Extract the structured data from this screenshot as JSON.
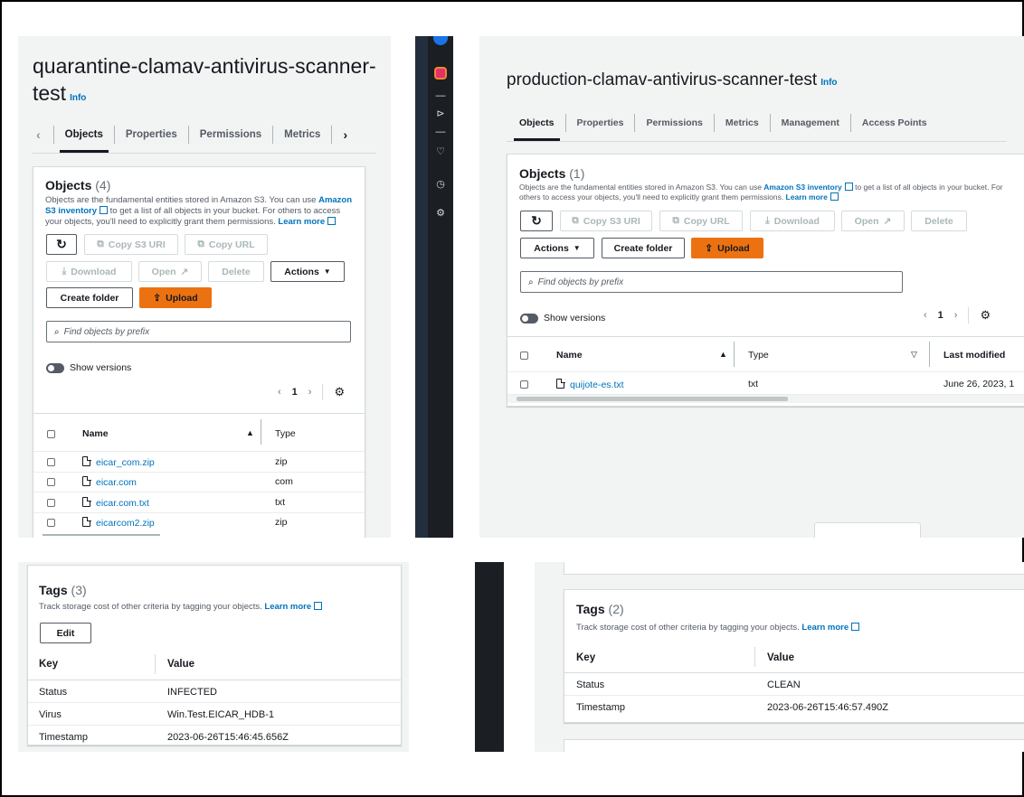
{
  "left_panel": {
    "title_line1": "quarantine-clamav-antivirus-scanner-",
    "title_line2": "test",
    "info": "Info",
    "tabs": [
      "Objects",
      "Properties",
      "Permissions",
      "Metrics"
    ],
    "objects": {
      "title": "Objects",
      "count": "(4)",
      "description_pre": "Objects are the fundamental entities stored in Amazon S3. You can use ",
      "description_link": "Amazon S3 inventory",
      "description_mid": " to get a list of all objects in your bucket. For others to access your objects, you'll need to explicitly grant them permissions. ",
      "description_learn": "Learn more",
      "copy_s3_uri": "Copy S3 URI",
      "copy_url": "Copy URL",
      "download": "Download",
      "open": "Open",
      "delete": "Delete",
      "actions": "Actions",
      "create_folder": "Create folder",
      "upload": "Upload",
      "search_placeholder": "Find objects by prefix",
      "show_versions": "Show versions",
      "page": "1",
      "col_name": "Name",
      "col_type": "Type",
      "rows": [
        {
          "name": "eicar_com.zip",
          "type": "zip"
        },
        {
          "name": "eicar.com",
          "type": "com"
        },
        {
          "name": "eicar.com.txt",
          "type": "txt"
        },
        {
          "name": "eicarcom2.zip",
          "type": "zip"
        }
      ]
    }
  },
  "right_panel": {
    "title": "production-clamav-antivirus-scanner-test",
    "info": "Info",
    "tabs": [
      "Objects",
      "Properties",
      "Permissions",
      "Metrics",
      "Management",
      "Access Points"
    ],
    "objects": {
      "title": "Objects",
      "count": "(1)",
      "description_pre": "Objects are the fundamental entities stored in Amazon S3. You can use ",
      "description_link": "Amazon S3 inventory",
      "description_mid": " to get a list of all objects in your bucket. For others to access your objects, you'll need to explicitly grant them permissions. ",
      "description_learn": "Learn more",
      "copy_s3_uri": "Copy S3 URI",
      "copy_url": "Copy URL",
      "download": "Download",
      "open": "Open",
      "delete": "Delete",
      "actions": "Actions",
      "create_folder": "Create folder",
      "upload": "Upload",
      "search_placeholder": "Find objects by prefix",
      "show_versions": "Show versions",
      "page": "1",
      "col_name": "Name",
      "col_type": "Type",
      "col_last_modified": "Last modified",
      "rows": [
        {
          "name": "quijote-es.txt",
          "type": "txt",
          "last_modified": "June 26, 2023, 1"
        }
      ]
    }
  },
  "left_tags": {
    "title": "Tags",
    "count": "(3)",
    "description": "Track storage cost of other criteria by tagging your objects.",
    "learn_more": "Learn more",
    "edit": "Edit",
    "col_key": "Key",
    "col_value": "Value",
    "rows": [
      {
        "key": "Status",
        "value": "INFECTED"
      },
      {
        "key": "Virus",
        "value": "Win.Test.EICAR_HDB-1"
      },
      {
        "key": "Timestamp",
        "value": "2023-06-26T15:46:45.656Z"
      }
    ]
  },
  "right_tags": {
    "title": "Tags",
    "count": "(2)",
    "description": "Track storage cost of other criteria by tagging your objects.",
    "learn_more": "Learn more",
    "col_key": "Key",
    "col_value": "Value",
    "rows": [
      {
        "key": "Status",
        "value": "CLEAN"
      },
      {
        "key": "Timestamp",
        "value": "2023-06-26T15:46:57.490Z"
      }
    ]
  },
  "colors": {
    "primary_orange": "#ec7211",
    "link_blue": "#0073bb",
    "dark_nav": "#232f3e",
    "instagram_pink": "#e1306c"
  }
}
